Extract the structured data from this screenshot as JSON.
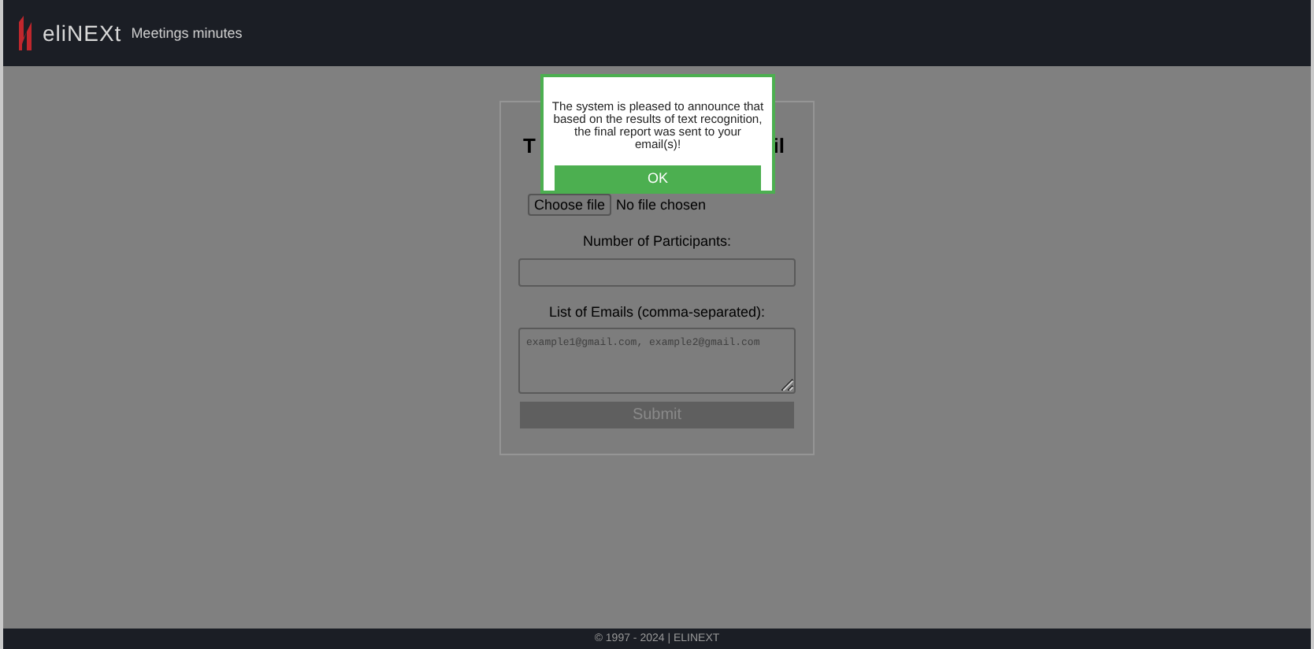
{
  "header": {
    "logo": "eliNEXt",
    "title": "Meetings minutes"
  },
  "form": {
    "heading_left": "T",
    "heading_right": "il",
    "file_button": "Choose file",
    "file_status": "No file chosen",
    "participants_label": "Number of Participants:",
    "emails_label": "List of Emails (comma-separated):",
    "emails_placeholder": "example1@gmail.com, example2@gmail.com",
    "submit": "Submit",
    "submit_disabled": true
  },
  "dialog": {
    "message": "The system is pleased to announce that based on the results of text recognition, the final report was sent to your email(s)!",
    "button": "OK"
  },
  "footer": "© 1997 - 2024 | ELINEXT"
}
